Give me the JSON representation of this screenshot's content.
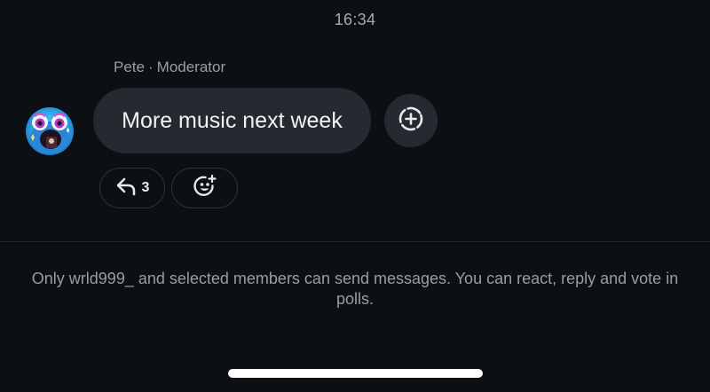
{
  "chat": {
    "timestamp": "16:34",
    "message": {
      "sender_name": "Pete",
      "separator": "·",
      "sender_role": "Moderator",
      "text": "More music next week",
      "reply_count": "3"
    },
    "icons": {
      "add_reaction": "add-reaction-icon",
      "reply": "reply-icon",
      "emoji": "emoji-add-icon"
    }
  },
  "composer_notice": {
    "text": "Only wrld999_ and selected members can send messages. You can react, reply and vote in polls."
  },
  "colors": {
    "background": "#0c0f14",
    "bubble": "#262930",
    "muted_text": "#9a9da4"
  }
}
